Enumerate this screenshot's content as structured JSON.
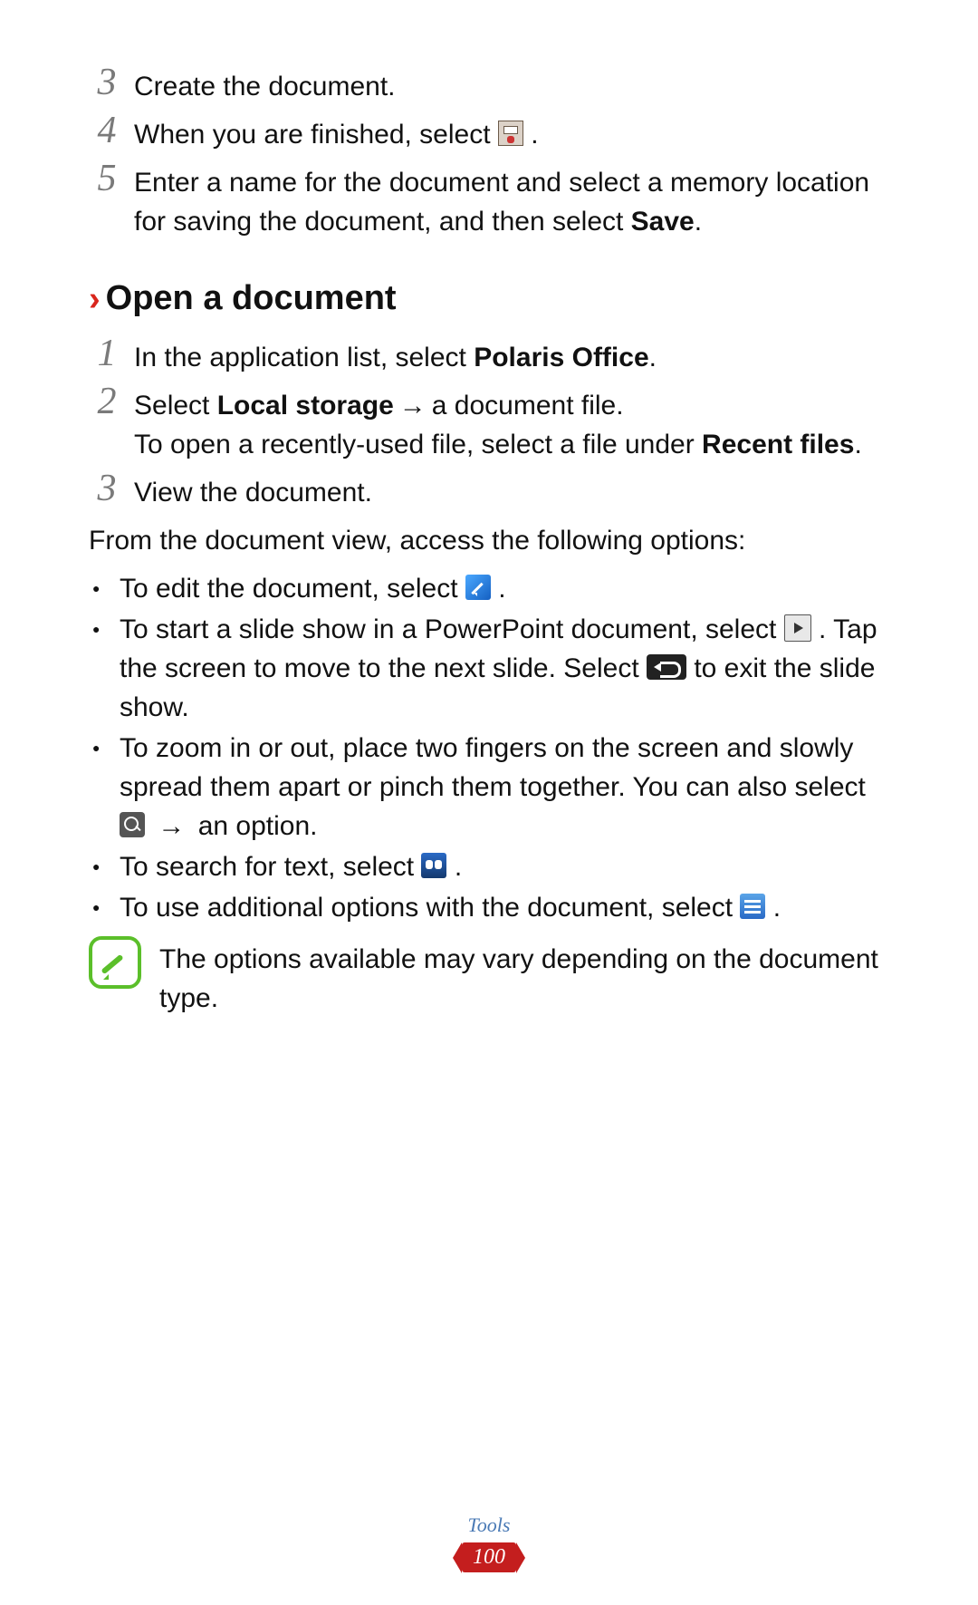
{
  "topSteps": {
    "s3": {
      "num": "3",
      "text": "Create the document."
    },
    "s4": {
      "num": "4",
      "prefix": "When you are finished, select ",
      "suffix": "."
    },
    "s5": {
      "num": "5",
      "textA": "Enter a name for the document and select a memory location for saving the document, and then select ",
      "bold": "Save",
      "textB": "."
    }
  },
  "section": {
    "chevron": "›",
    "title": "Open a document"
  },
  "openSteps": {
    "s1": {
      "num": "1",
      "textA": "In the application list, select ",
      "bold": "Polaris Office",
      "textB": "."
    },
    "s2": {
      "num": "2",
      "line1a": "Select ",
      "line1bold": "Local storage",
      "arrow": " → ",
      "line1b": "a document file.",
      "line2a": "To open a recently-used file, select a file under ",
      "line2bold": "Recent files",
      "line2b": "."
    },
    "s3": {
      "num": "3",
      "text": "View the document."
    }
  },
  "lead": "From the document view, access the following options:",
  "bullets": {
    "b1": {
      "a": "To edit the document, select ",
      "b": "."
    },
    "b2": {
      "a": "To start a slide show in a PowerPoint document, select ",
      "b": ". Tap the screen to move to the next slide. Select ",
      "c": " to exit the slide show."
    },
    "b3": {
      "a": "To zoom in or out, place two fingers on the screen and slowly spread them apart or pinch them together. You can also select ",
      "arrow": " → ",
      "b": "an option."
    },
    "b4": {
      "a": "To search for text, select ",
      "b": "."
    },
    "b5": {
      "a": "To use additional options with the document, select ",
      "b": "."
    }
  },
  "note": "The options available may vary depending on the document type.",
  "footer": {
    "category": "Tools",
    "page": "100"
  }
}
